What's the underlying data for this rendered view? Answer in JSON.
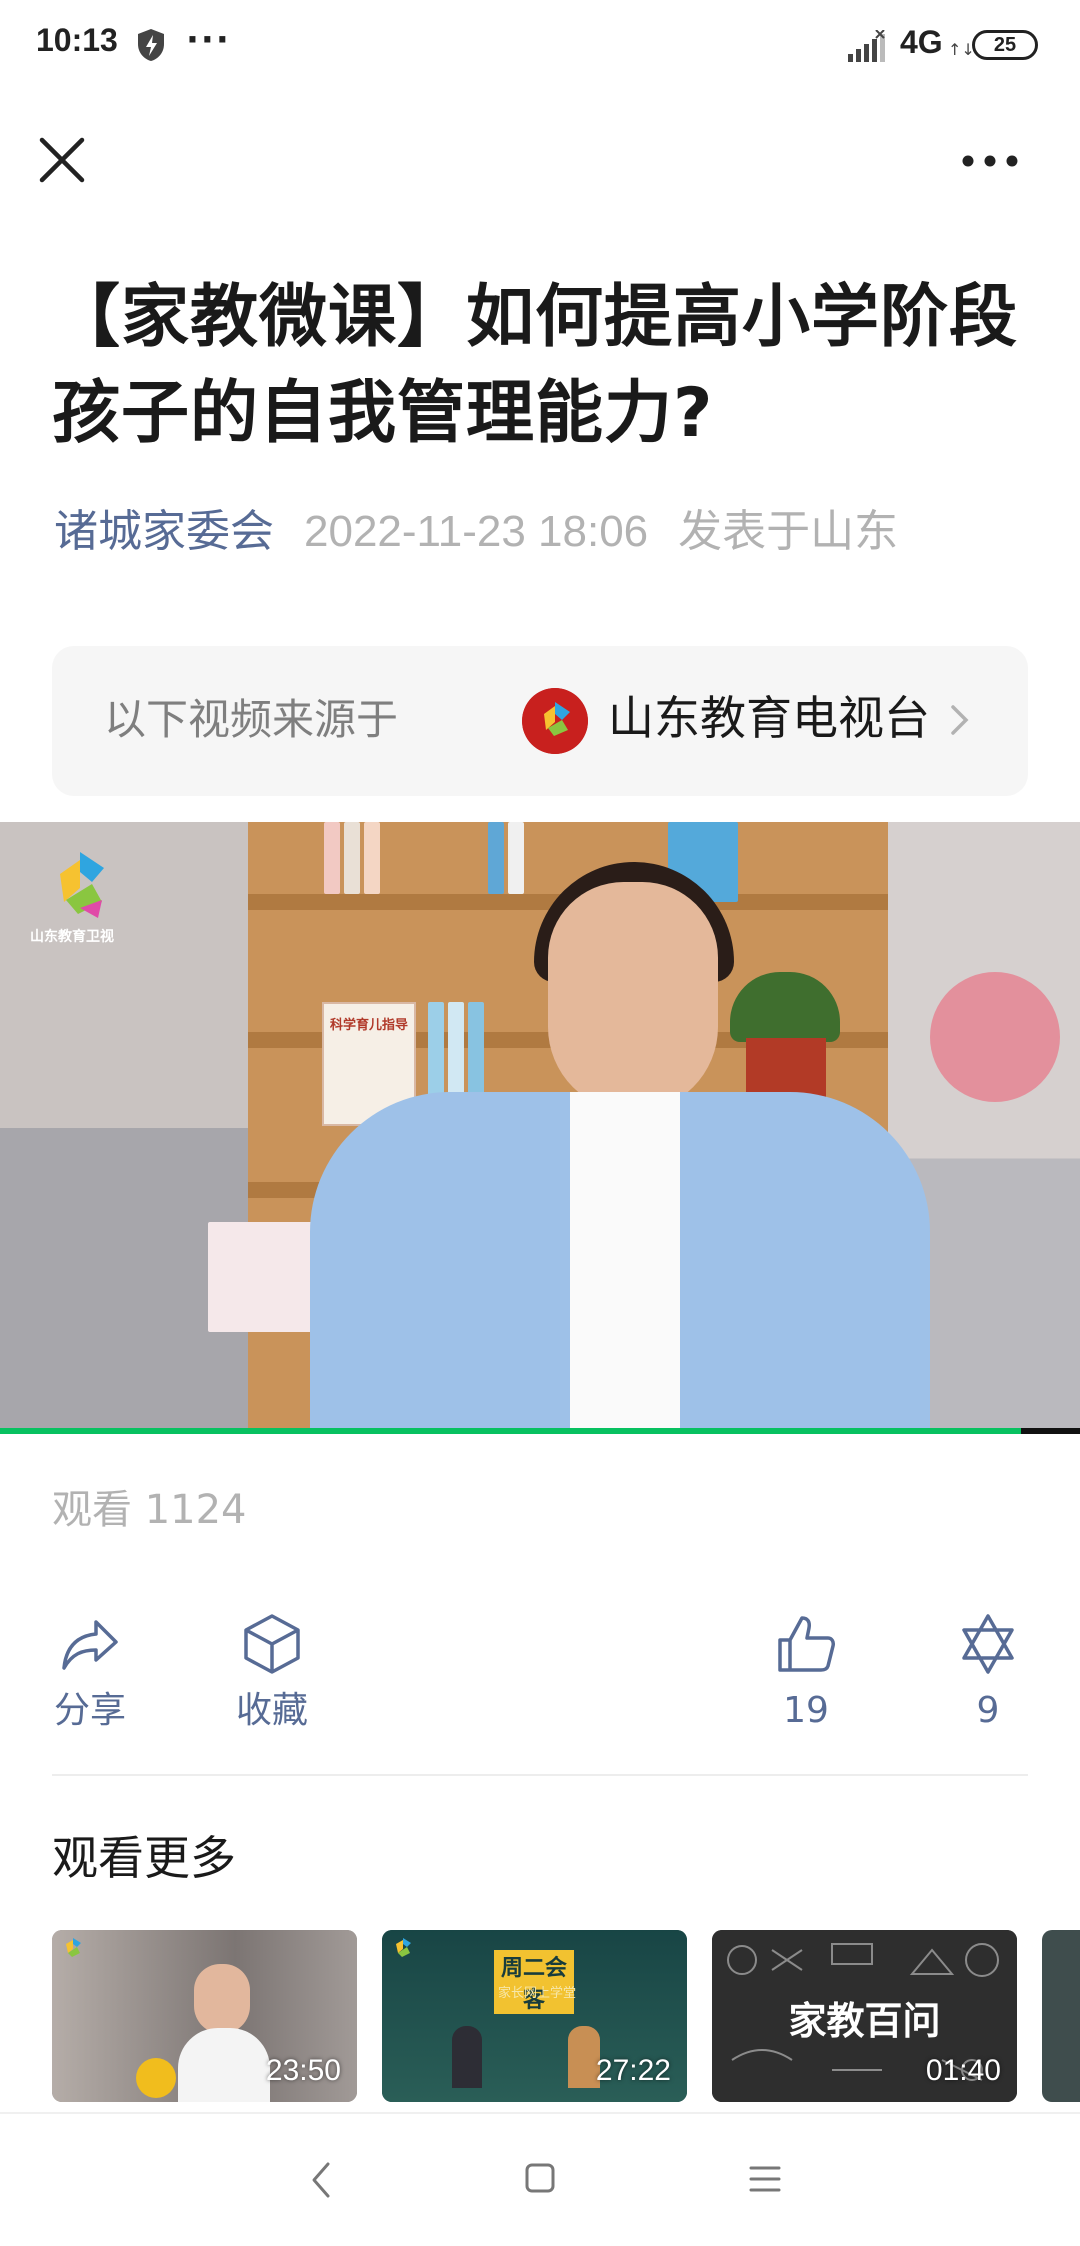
{
  "status_bar": {
    "time": "10:13",
    "dots": "···",
    "network": "4G",
    "network_arrows": "↑↓",
    "battery": "25"
  },
  "article": {
    "title": "【家教微课】如何提高小学阶段孩子的自我管理能力?",
    "author": "诸城家委会",
    "date": "2022-11-23 18:06",
    "location": "发表于山东"
  },
  "video_source": {
    "label": "以下视频来源于",
    "channel": "山东教育电视台"
  },
  "video": {
    "watermark": "山东教育卫视",
    "book_label": "科学育儿指导",
    "progress": 0.945
  },
  "views": {
    "text": "观看 1124"
  },
  "actions": {
    "share_label": "分享",
    "favorite_label": "收藏",
    "like_count": "19",
    "wow_count": "9"
  },
  "more": {
    "heading": "观看更多",
    "videos": [
      {
        "duration": "23:50"
      },
      {
        "duration": "27:22",
        "banner": "周二会客",
        "sub": "家长网上学堂"
      },
      {
        "duration": "01:40",
        "title": "家教百问"
      }
    ]
  },
  "colors": {
    "accent_blue": "#576b95",
    "progress_green": "#07c160",
    "channel_red": "#c8201e"
  }
}
